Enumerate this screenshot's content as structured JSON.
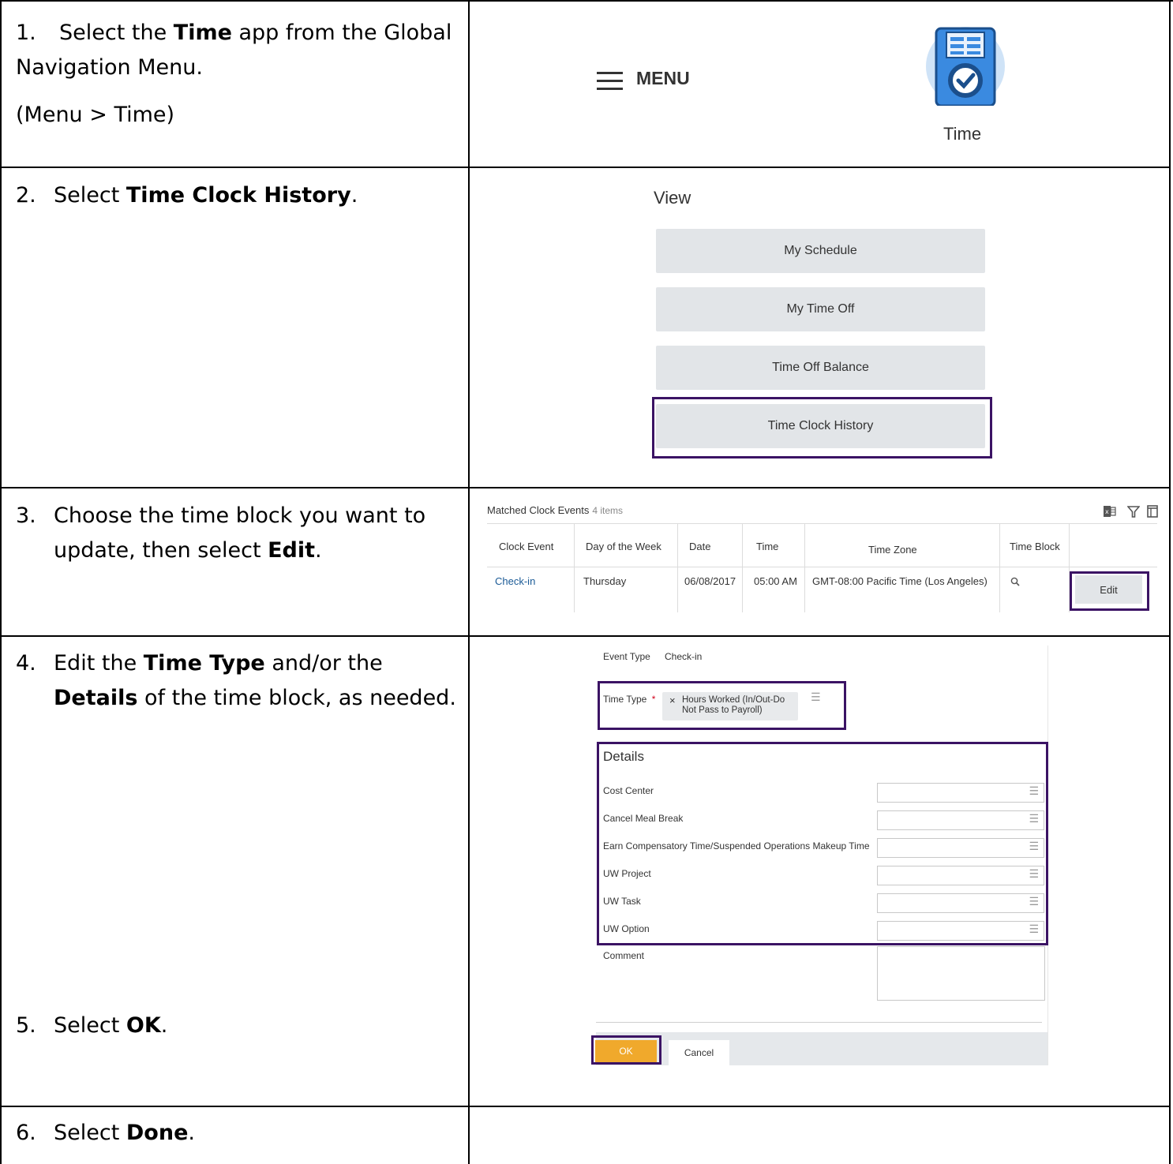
{
  "steps": {
    "s1_num": "1.",
    "s1_pre": "Select the ",
    "s1_bold": "Time",
    "s1_post": " app from the Global",
    "s1_line2": "Navigation Menu.",
    "s1_line3": "(Menu > Time)",
    "s2_num": "2.",
    "s2_pre": "Select ",
    "s2_bold": "Time Clock History",
    "s2_post": ".",
    "s3_num": "3.",
    "s3_line1": "Choose the time block you want to",
    "s3_pre": "update, then select ",
    "s3_bold": "Edit",
    "s3_post": ".",
    "s4_num": "4.",
    "s4_pre": "Edit the ",
    "s4_bold1": "Time Type",
    "s4_mid": " and/or the",
    "s4_bold2": "Details",
    "s4_post": " of the time block, as needed.",
    "s5_num": "5.",
    "s5_pre": "Select ",
    "s5_bold": "OK",
    "s5_post": ".",
    "s6_num": "6.",
    "s6_pre": "Select ",
    "s6_bold": "Done",
    "s6_post": "."
  },
  "menu": {
    "label": "MENU",
    "icon": "hamburger-menu-icon"
  },
  "time_app": {
    "label": "Time",
    "icon": "time-clock-app-icon"
  },
  "view_panel": {
    "label": "View",
    "buttons": [
      "My Schedule",
      "My Time Off",
      "Time Off Balance",
      "Time Clock History"
    ]
  },
  "clock_table": {
    "title": "Matched Clock Events",
    "count": "4 items",
    "headers": [
      "Clock Event",
      "Day of the Week",
      "Date",
      "Time",
      "Time Zone",
      "Time Block"
    ],
    "row": {
      "clock_event": "Check-in",
      "day": "Thursday",
      "date": "06/08/2017",
      "time": "05:00 AM",
      "zone": "GMT-08:00 Pacific Time (Los Angeles)",
      "edit": "Edit"
    },
    "tools": [
      "excel-export-icon",
      "filter-icon",
      "column-icon"
    ]
  },
  "edit_form": {
    "event_type_label": "Event Type",
    "event_type_value": "Check-in",
    "time_type_label": "Time Type",
    "required_mark": "*",
    "time_type_value_line1": "Hours Worked (In/Out-Do",
    "time_type_value_line2": "Not Pass to Payroll)",
    "details_heading": "Details",
    "fields": [
      "Cost Center",
      "Cancel Meal Break",
      "Earn Compensatory Time/Suspended Operations Makeup Time",
      "UW Project",
      "UW Task",
      "UW Option"
    ],
    "comment_label": "Comment",
    "ok": "OK",
    "cancel": "Cancel"
  },
  "colors": {
    "highlight": "#3b1364",
    "ok_button": "#f0a92c",
    "link": "#1a5a96",
    "button_gray": "#e2e5e8"
  }
}
